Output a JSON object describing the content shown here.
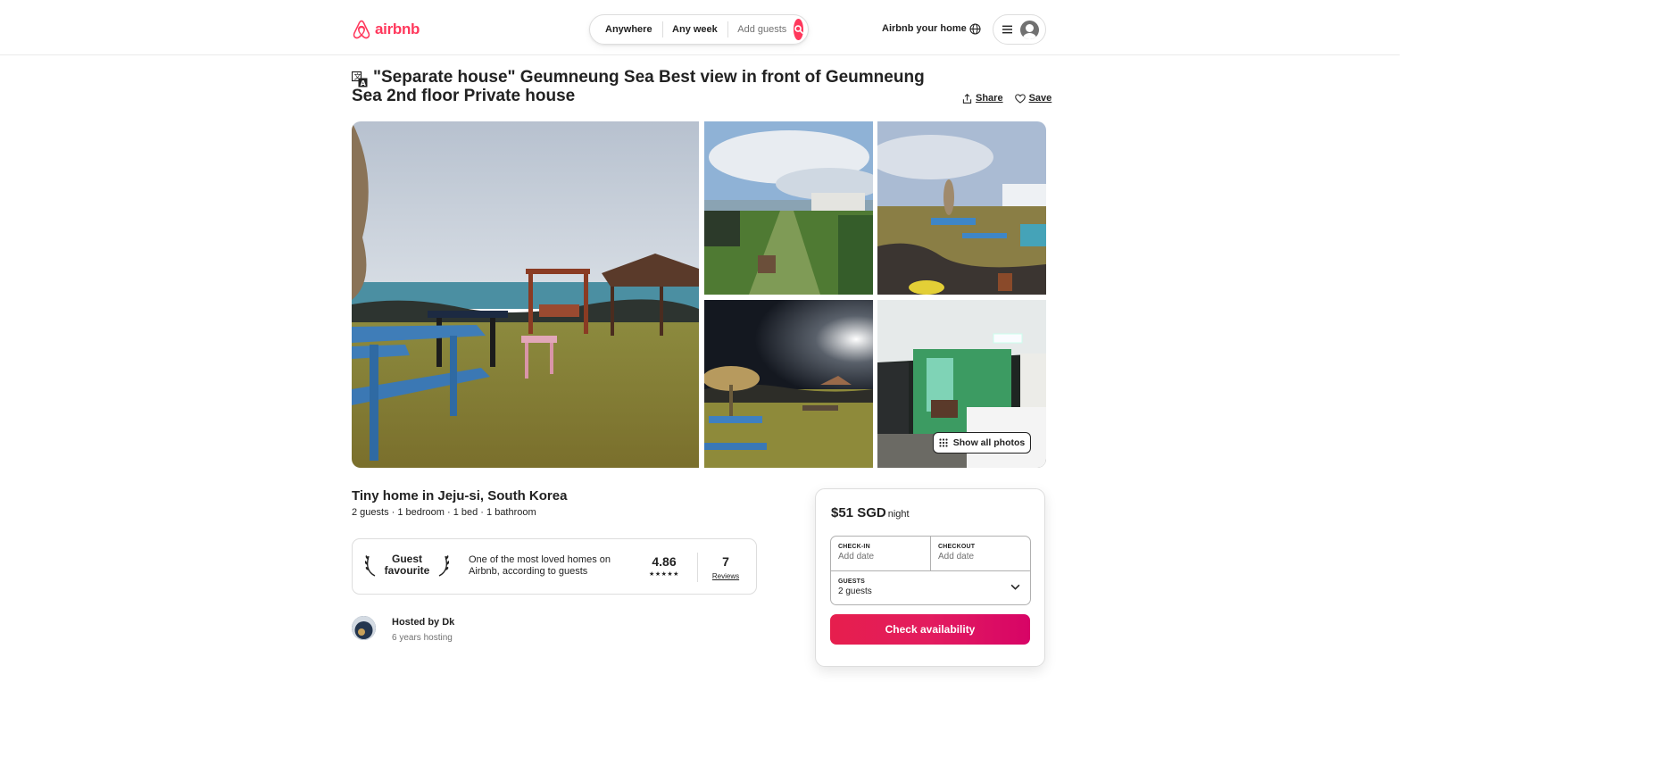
{
  "header": {
    "logo_text": "airbnb",
    "search": {
      "where": "Anywhere",
      "when": "Any week",
      "guests": "Add guests"
    },
    "host_link": "Airbnb your home"
  },
  "listing": {
    "title": "\"Separate house\" Geumneung Sea Best view in front of Geumneung Sea 2nd floor Private house",
    "share_label": "Share",
    "save_label": "Save",
    "show_all_photos": "Show all photos",
    "type_location": "Tiny home in Jeju-si, South Korea",
    "summary": "2 guests · 1 bedroom · 1 bed · 1 bathroom"
  },
  "guest_favourite": {
    "badge_line1": "Guest",
    "badge_line2": "favourite",
    "description": "One of the most loved homes on Airbnb, according to guests",
    "rating": "4.86",
    "stars": "★★★★★",
    "review_count": "7",
    "reviews_label": "Reviews"
  },
  "host": {
    "name": "Hosted by Dk",
    "years": "6 years hosting"
  },
  "booking": {
    "price": "$51 SGD",
    "price_unit": "night",
    "checkin_label": "CHECK-IN",
    "checkin_value": "Add date",
    "checkout_label": "CHECKOUT",
    "checkout_value": "Add date",
    "guests_label": "GUESTS",
    "guests_value": "2 guests",
    "button_label": "Check availability"
  },
  "colors": {
    "brand": "#ff385c",
    "button_gradient_start": "#e61e4d",
    "button_gradient_end": "#d70466",
    "text_primary": "#222222",
    "text_secondary": "#717171",
    "border": "#dddddd"
  }
}
